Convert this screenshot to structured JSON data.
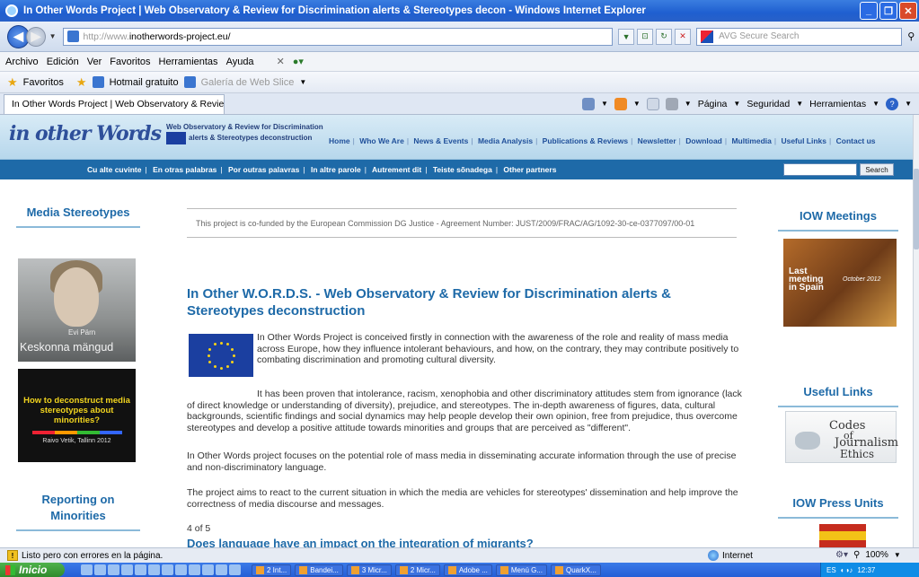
{
  "window": {
    "title": "In Other Words Project | Web Observatory & Review for Discrimination alerts & Stereotypes decon - Windows Internet Explorer"
  },
  "address": {
    "url_prefix": "http://www.",
    "url_host": "inotherwords-project.eu/",
    "search_placeholder": "AVG Secure Search"
  },
  "menu": [
    "Archivo",
    "Edición",
    "Ver",
    "Favoritos",
    "Herramientas",
    "Ayuda"
  ],
  "favorites": {
    "label": "Favoritos",
    "items": [
      "Hotmail gratuito",
      "Galería de Web Slice"
    ]
  },
  "tab": {
    "title": "In Other Words Project | Web Observatory & Review ..."
  },
  "commands": [
    "Página",
    "Seguridad",
    "Herramientas"
  ],
  "site": {
    "logo_script": "in other Words",
    "logo_sub_1": "Web Observatory & Review for Discrimination",
    "logo_sub_2": "alerts & Stereotypes deconstruction",
    "top_nav": [
      "Home",
      "Who We Are",
      "News & Events",
      "Media Analysis",
      "Publications & Reviews",
      "Newsletter",
      "Download",
      "Multimedia",
      "Useful Links",
      "Contact us"
    ],
    "lang_nav": [
      "Cu alte cuvinte",
      "En otras palabras",
      "Por outras palavras",
      "In altre parole",
      "Autrement dit",
      "Teiste sõnadega",
      "Other partners"
    ],
    "search_button": "Search"
  },
  "left": {
    "media_heading": "Media Stereotypes",
    "image_name": "Evi Pärn",
    "image_caption": "Keskonna mängud",
    "howto_text": "How to deconstruct media stereotypes about minorities?",
    "howto_credit": "Raivo Vetik, Tallinn 2012",
    "reporting_heading": "Reporting on Minorities"
  },
  "center": {
    "cofund": "This project is co-funded by the European Commission DG Justice - Agreement Number: JUST/2009/FRAC/AG/1092-30-ce-0377097/00-01",
    "title": "In Other W.O.R.D.S. - Web Observatory & Review for Discrimination alerts & Stereotypes deconstruction",
    "p1": "In Other Words Project is conceived firstly in connection with the awareness of the role and reality of mass media across Europe, how they influence intolerant behaviours, and how, on the contrary, they may contribute positively to combating discrimination and promoting cultural diversity.",
    "p2": "It has been proven that intolerance, racism, xenophobia and other discriminatory attitudes stem from ignorance (lack of direct knowledge or understanding of diversity), prejudice, and stereotypes. The in-depth awareness of figures, data, cultural backgrounds, scientific findings and social dynamics may help people develop their own opinion, free from prejudice, thus overcome stereotypes and develop a positive attitude towards minorities and groups that are perceived as \"different\".",
    "p3": "In Other Words project focuses on the potential role of mass media in disseminating accurate information through the use of precise and non-discriminatory language.",
    "p4": "The project aims to react to the current situation in which the media are vehicles for stereotypes' dissemination and help improve the correctness of media discourse and messages.",
    "pager": "4 of 5",
    "next_title": "Does language have an impact on the integration of migrants?"
  },
  "right": {
    "meetings_heading": "IOW Meetings",
    "meet_last": "Last meeting in Spain",
    "meet_date": "October 2012",
    "useful_heading": "Useful Links",
    "codes_1": "Codes",
    "codes_2": "of",
    "codes_3": "Journalism",
    "codes_4": "Ethics",
    "press_heading": "IOW Press Units"
  },
  "status": {
    "text": "Listo pero con errores en la página.",
    "zone": "Internet",
    "zoom": "100%"
  },
  "taskbar": {
    "start": "Inicio",
    "tasks": [
      "2 Int...",
      "Bandei...",
      "3 Micr...",
      "2 Micr...",
      "Adobe ...",
      "Menú G...",
      "QuarkX..."
    ],
    "lang": "ES",
    "clock": "12:37"
  }
}
